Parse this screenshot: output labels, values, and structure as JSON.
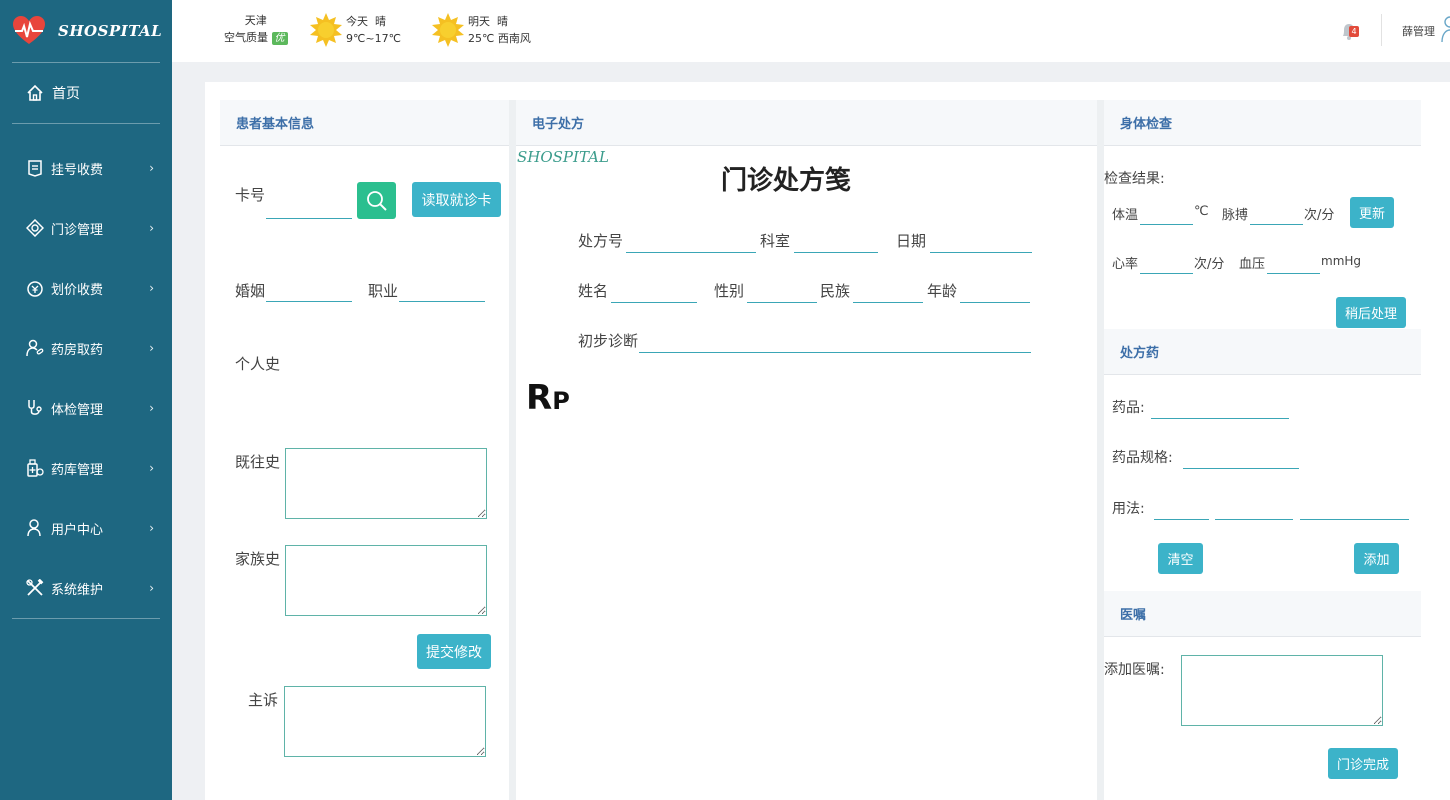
{
  "brand": {
    "name": "SHOSPITAL"
  },
  "sidebar": {
    "home_label": "首页",
    "items": [
      {
        "label": "挂号收费",
        "icon": "registration-icon"
      },
      {
        "label": "门诊管理",
        "icon": "outpatient-icon"
      },
      {
        "label": "划价收费",
        "icon": "billing-icon"
      },
      {
        "label": "药房取药",
        "icon": "pharmacy-icon"
      },
      {
        "label": "体检管理",
        "icon": "stethoscope-icon"
      },
      {
        "label": "药库管理",
        "icon": "medicine-store-icon"
      },
      {
        "label": "用户中心",
        "icon": "user-icon"
      },
      {
        "label": "系统维护",
        "icon": "tools-icon"
      }
    ]
  },
  "topbar": {
    "city": "天津",
    "air_quality_label": "空气质量",
    "air_quality_value": "优",
    "today": {
      "day": "今天",
      "condition": "晴",
      "detail": "9℃~17℃"
    },
    "tomorrow": {
      "day": "明天",
      "condition": "晴",
      "detail": "25℃ 西南风"
    },
    "notifications": "4",
    "user": "薛管理"
  },
  "patient": {
    "title": "患者基本信息",
    "card_label": "卡号",
    "card_value": "",
    "read_card_button": "读取就诊卡",
    "marriage_label": "婚姻",
    "job_label": "职业",
    "personal_history_label": "个人史",
    "past_history_label": "既往史",
    "family_history_label": "家族史",
    "submit_button": "提交修改",
    "complaint_label": "主诉"
  },
  "prescription": {
    "title": "电子处方",
    "watermark": "SHOSPITAL",
    "doc_title": "门诊处方笺",
    "rx_no_label": "处方号",
    "dept_label": "科室",
    "date_label": "日期",
    "name_label": "姓名",
    "gender_label": "性别",
    "ethnic_label": "民族",
    "age_label": "年龄",
    "diagnosis_label": "初步诊断",
    "rp_big": "R",
    "rp_small": "P"
  },
  "exam": {
    "title": "身体检查",
    "result_label": "检查结果:",
    "temp_label": "体温",
    "temp_unit": "℃",
    "pulse_label": "脉搏",
    "pulse_unit": "次/分",
    "update_button": "更新",
    "hr_label": "心率",
    "hr_unit": "次/分",
    "bp_label": "血压",
    "bp_unit": "mmHg",
    "later_button": "稍后处理"
  },
  "drug": {
    "title": "处方药",
    "name_label": "药品:",
    "spec_label": "药品规格:",
    "usage_label": "用法:",
    "clear_button": "清空",
    "add_button": "添加"
  },
  "advice": {
    "title": "医嘱",
    "add_label": "添加医嘱:",
    "finish_button": "门诊完成"
  },
  "colors": {
    "sidebar": "#1e6781",
    "accent": "#3cb3c9",
    "search_button": "#2bbf8f",
    "panel_title": "#3d6fa8"
  }
}
